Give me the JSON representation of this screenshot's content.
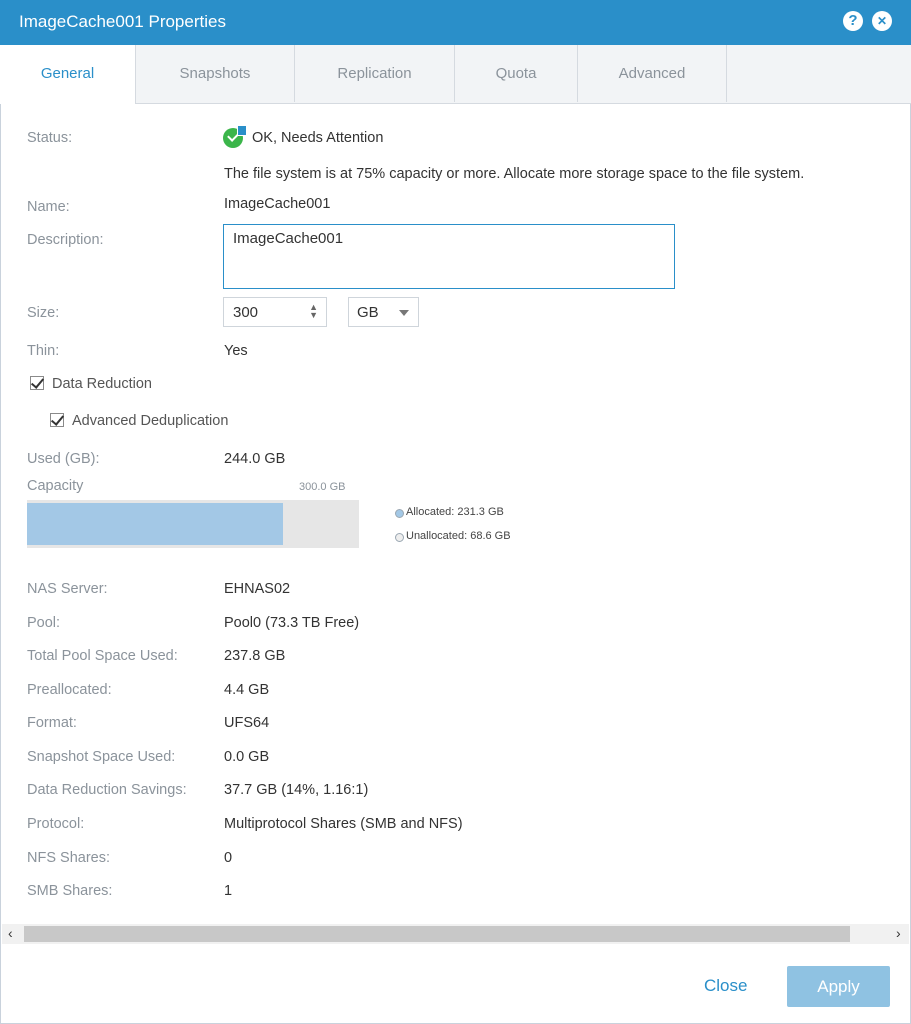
{
  "dialog": {
    "title": "ImageCache001 Properties",
    "help_glyph": "?",
    "close_glyph": "✕"
  },
  "tabs": [
    "General",
    "Snapshots",
    "Replication",
    "Quota",
    "Advanced"
  ],
  "general": {
    "status_label": "Status:",
    "status_value": "OK, Needs Attention",
    "status_message": "The file system is at 75% capacity or more. Allocate more storage space to the file system.",
    "name_label": "Name:",
    "name_value": "ImageCache001",
    "description_label": "Description:",
    "description_value": "ImageCache001",
    "size_label": "Size:",
    "size_value": "300",
    "size_unit": "GB",
    "thin_label": "Thin:",
    "thin_value": "Yes",
    "data_reduction_label": "Data Reduction",
    "data_reduction_checked": true,
    "advanced_dedup_label": "Advanced Deduplication",
    "advanced_dedup_checked": true,
    "used_label": "Used (GB):",
    "used_value": "244.0 GB",
    "capacity_label": "Capacity",
    "capacity_total": "300.0 GB",
    "allocated_fraction": 0.771,
    "allocated_legend": "Allocated: 231.3 GB",
    "unallocated_legend": "Unallocated: 68.6 GB",
    "details": [
      {
        "label": "NAS Server:",
        "value": "EHNAS02"
      },
      {
        "label": "Pool:",
        "value": "Pool0 (73.3 TB Free)"
      },
      {
        "label": "Total Pool Space Used:",
        "value": "237.8 GB"
      },
      {
        "label": "Preallocated:",
        "value": "4.4 GB"
      },
      {
        "label": "Format:",
        "value": "UFS64"
      },
      {
        "label": "Snapshot Space Used:",
        "value": "0.0 GB"
      },
      {
        "label": "Data Reduction Savings:",
        "value": "37.7 GB (14%, 1.16:1)"
      },
      {
        "label": "Protocol:",
        "value": "Multiprotocol Shares (SMB and NFS)"
      },
      {
        "label": "NFS Shares:",
        "value": "0"
      },
      {
        "label": "SMB Shares:",
        "value": "1"
      }
    ]
  },
  "footer": {
    "close_label": "Close",
    "apply_label": "Apply"
  },
  "colors": {
    "accent": "#2a8fc9",
    "ok_green": "#3bb54a",
    "bar_fill": "#a3c8e6"
  }
}
